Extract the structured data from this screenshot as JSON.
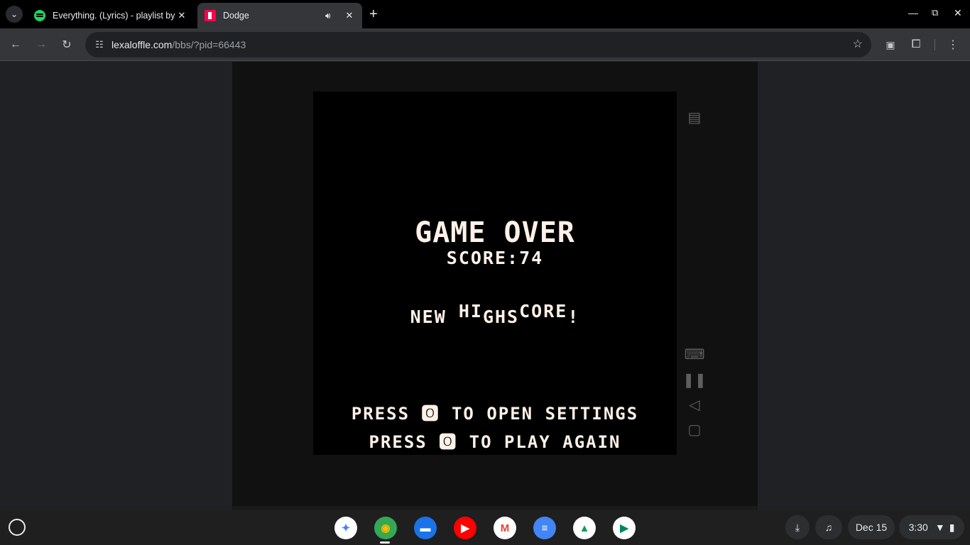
{
  "browser": {
    "tabs": [
      {
        "title": "Everything. (Lyrics) - playlist by",
        "favicon": "spotify-icon",
        "active": false
      },
      {
        "title": "Dodge",
        "favicon": "lexaloffle-icon",
        "active": true
      }
    ],
    "url_host": "lexaloffle.com",
    "url_path": "/bbs/?pid=66443"
  },
  "game": {
    "title": "GAME OVER",
    "score_label": "SCORE:74",
    "highscore_part1": "NEW ",
    "highscore_part2": "HI",
    "highscore_part3": "GHS",
    "highscore_part4": "CORE",
    "highscore_part5": "!",
    "line1_press": "PRESS ",
    "line1_rest": " TO OPEN SETTINGS",
    "line2_press": "PRESS ",
    "line2_rest": " TO PLAY AGAIN",
    "button_glyph": "🅾"
  },
  "shelf": {
    "date": "Dec 15",
    "time": "3:30",
    "apps": [
      {
        "name": "Gemini",
        "glyph": "✦",
        "color": "#ffffff",
        "fg": "#4285f4"
      },
      {
        "name": "Chrome",
        "glyph": "◉",
        "color": "#34a853",
        "fg": "#fbbc04"
      },
      {
        "name": "Files",
        "glyph": "▬",
        "color": "#1a73e8",
        "fg": "#ffffff"
      },
      {
        "name": "YouTube",
        "glyph": "▶",
        "color": "#ff0000",
        "fg": "#ffffff"
      },
      {
        "name": "Gmail",
        "glyph": "M",
        "color": "#ffffff",
        "fg": "#ea4335"
      },
      {
        "name": "Docs",
        "glyph": "≡",
        "color": "#4285f4",
        "fg": "#ffffff"
      },
      {
        "name": "Drive",
        "glyph": "▲",
        "color": "#ffffff",
        "fg": "#0f9d58"
      },
      {
        "name": "Play Store",
        "glyph": "▶",
        "color": "#ffffff",
        "fg": "#01875f"
      }
    ]
  },
  "colors": {
    "pico_white": "#fff1e8",
    "accent_pink": "#ff004d"
  }
}
